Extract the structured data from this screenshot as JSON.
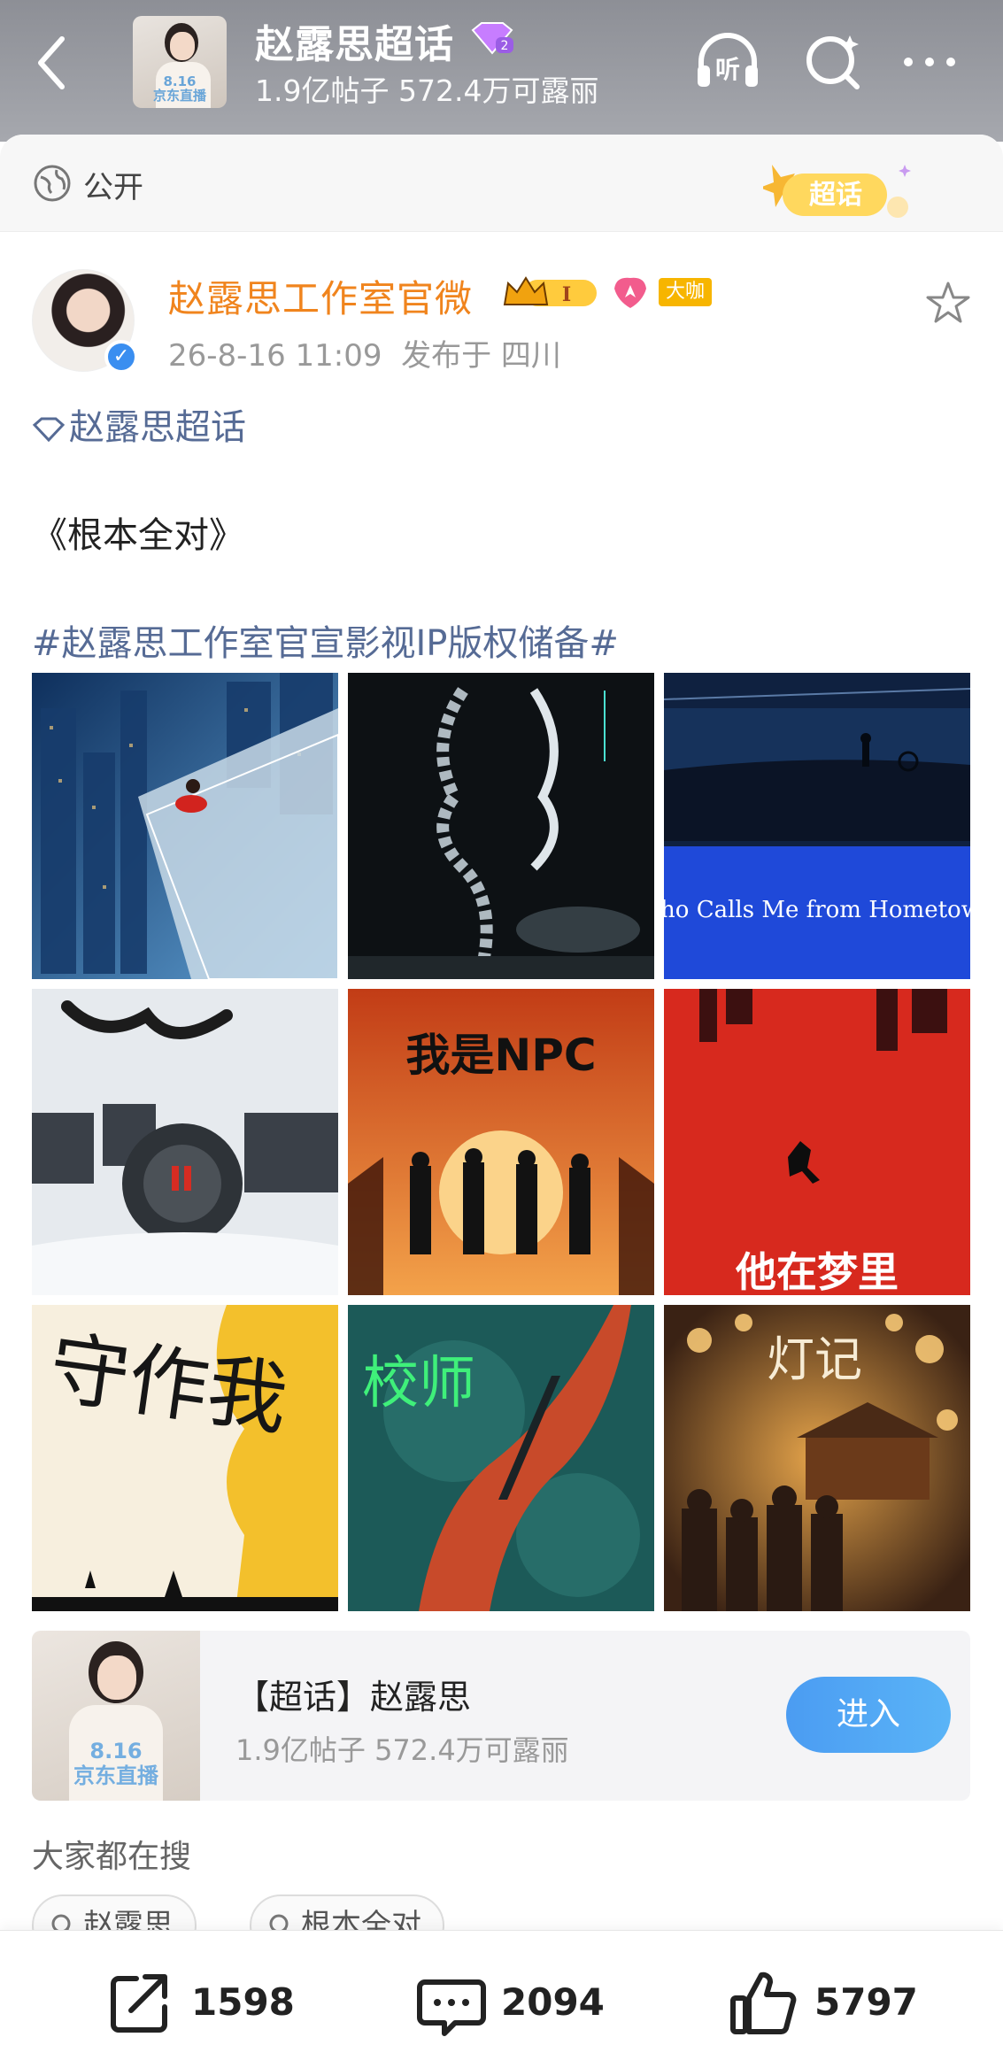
{
  "header": {
    "title": "赵露思超话",
    "subtitle": "1.9亿帖子 572.4万可露丽",
    "cover_text": "8.16\n京东直播",
    "listen_label": "听"
  },
  "panel": {
    "visibility_label": "公开",
    "badge_label": "超话"
  },
  "post": {
    "author": "赵露思工作室官微",
    "level_badge": "I",
    "role_badge": "大咖",
    "verified_mark": "✓",
    "time": "26-8-16 11:09",
    "location": "发布于 四川",
    "topic": "赵露思超话",
    "text": "《根本全对》",
    "hashtag": "#赵露思工作室官宣影视IP版权储备#",
    "images": [
      {
        "caption": "",
        "colors": [
          "#1e4d86",
          "#8bb0d0"
        ]
      },
      {
        "caption": "",
        "colors": [
          "#0e0f12",
          "#6c7a82"
        ]
      },
      {
        "caption": "Who Calls Me from Hometown",
        "colors": [
          "#102444",
          "#1b4ad6"
        ]
      },
      {
        "caption": "",
        "colors": [
          "#2c3137",
          "#e8edf2"
        ]
      },
      {
        "caption": "我是NPC",
        "colors": [
          "#c84418",
          "#f29a3a"
        ]
      },
      {
        "caption": "他在梦里",
        "colors": [
          "#d12a1f",
          "#e9402d"
        ]
      },
      {
        "caption": "守作我",
        "colors": [
          "#f5ead6",
          "#f2c12c"
        ]
      },
      {
        "caption": "校师",
        "colors": [
          "#1d5c5a",
          "#c9512d"
        ]
      },
      {
        "caption": "灯记",
        "colors": [
          "#3a2214",
          "#c88a3c"
        ]
      }
    ]
  },
  "supertopic_card": {
    "title": "【超话】赵露思",
    "subtitle": "1.9亿帖子 572.4万可露丽",
    "cover_text": "8.16\n京东直播",
    "button_label": "进入"
  },
  "searching": {
    "label": "大家都在搜",
    "chips": [
      "赵露思",
      "根本全对"
    ]
  },
  "actions": {
    "repost_count": "1598",
    "comment_count": "2094",
    "like_count": "5797"
  }
}
